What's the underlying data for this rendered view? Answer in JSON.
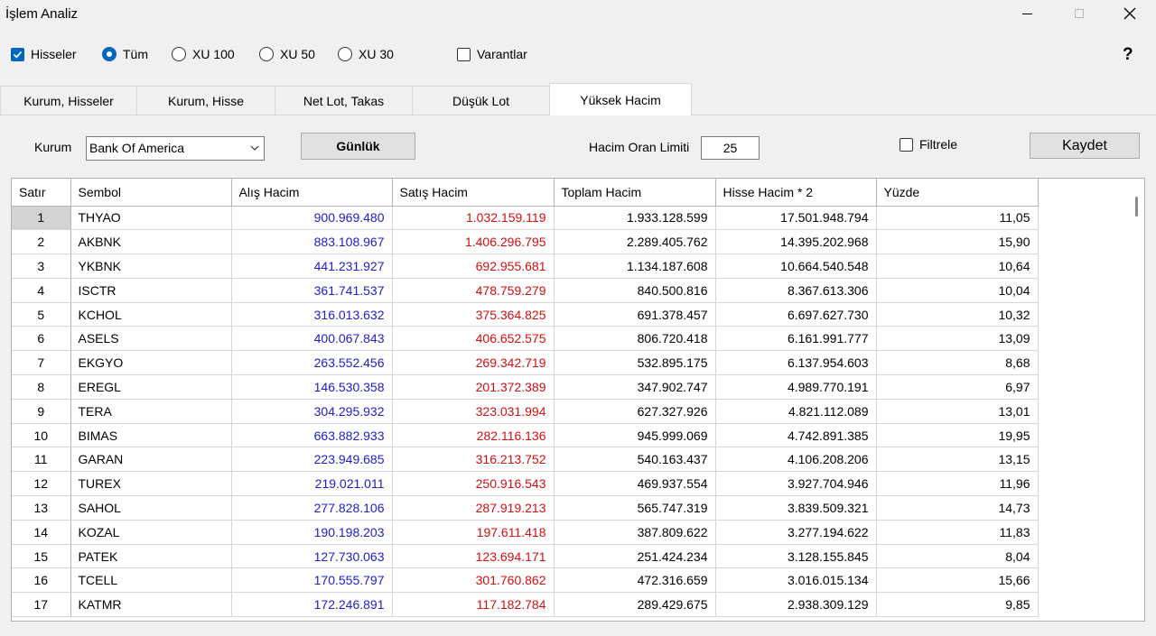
{
  "window": {
    "title": "İşlem Analiz"
  },
  "options": {
    "hisseler": {
      "label": "Hisseler",
      "checked": true
    },
    "radios": [
      {
        "label": "Tüm",
        "selected": true
      },
      {
        "label": "XU 100",
        "selected": false
      },
      {
        "label": "XU 50",
        "selected": false
      },
      {
        "label": "XU 30",
        "selected": false
      }
    ],
    "varantlar": {
      "label": "Varantlar",
      "checked": false
    },
    "help": "?"
  },
  "tabs": [
    {
      "label": "Kurum, Hisseler",
      "active": false
    },
    {
      "label": "Kurum, Hisse",
      "active": false
    },
    {
      "label": "Net Lot, Takas",
      "active": false
    },
    {
      "label": "Düşük Lot",
      "active": false
    },
    {
      "label": "Yüksek Hacim",
      "active": true
    }
  ],
  "filter": {
    "kurum_label": "Kurum",
    "kurum_value": "Bank Of America",
    "gunluk_button": "Günlük",
    "hacim_oran_label": "Hacim Oran Limiti",
    "hacim_oran_value": "25",
    "filtrele_label": "Filtrele",
    "filtrele_checked": false,
    "kaydet_button": "Kaydet"
  },
  "table": {
    "columns": [
      "Satır",
      "Sembol",
      "Alış Hacim",
      "Satış Hacim",
      "Toplam Hacim",
      "Hisse Hacim * 2",
      "Yüzde"
    ],
    "rows": [
      [
        "1",
        "THYAO",
        "900.969.480",
        "1.032.159.119",
        "1.933.128.599",
        "17.501.948.794",
        "11,05"
      ],
      [
        "2",
        "AKBNK",
        "883.108.967",
        "1.406.296.795",
        "2.289.405.762",
        "14.395.202.968",
        "15,90"
      ],
      [
        "3",
        "YKBNK",
        "441.231.927",
        "692.955.681",
        "1.134.187.608",
        "10.664.540.548",
        "10,64"
      ],
      [
        "4",
        "ISCTR",
        "361.741.537",
        "478.759.279",
        "840.500.816",
        "8.367.613.306",
        "10,04"
      ],
      [
        "5",
        "KCHOL",
        "316.013.632",
        "375.364.825",
        "691.378.457",
        "6.697.627.730",
        "10,32"
      ],
      [
        "6",
        "ASELS",
        "400.067.843",
        "406.652.575",
        "806.720.418",
        "6.161.991.777",
        "13,09"
      ],
      [
        "7",
        "EKGYO",
        "263.552.456",
        "269.342.719",
        "532.895.175",
        "6.137.954.603",
        "8,68"
      ],
      [
        "8",
        "EREGL",
        "146.530.358",
        "201.372.389",
        "347.902.747",
        "4.989.770.191",
        "6,97"
      ],
      [
        "9",
        "TERA",
        "304.295.932",
        "323.031.994",
        "627.327.926",
        "4.821.112.089",
        "13,01"
      ],
      [
        "10",
        "BIMAS",
        "663.882.933",
        "282.116.136",
        "945.999.069",
        "4.742.891.385",
        "19,95"
      ],
      [
        "11",
        "GARAN",
        "223.949.685",
        "316.213.752",
        "540.163.437",
        "4.106.208.206",
        "13,15"
      ],
      [
        "12",
        "TUREX",
        "219.021.011",
        "250.916.543",
        "469.937.554",
        "3.927.704.946",
        "11,96"
      ],
      [
        "13",
        "SAHOL",
        "277.828.106",
        "287.919.213",
        "565.747.319",
        "3.839.509.321",
        "14,73"
      ],
      [
        "14",
        "KOZAL",
        "190.198.203",
        "197.611.418",
        "387.809.622",
        "3.277.194.622",
        "11,83"
      ],
      [
        "15",
        "PATEK",
        "127.730.063",
        "123.694.171",
        "251.424.234",
        "3.128.155.845",
        "8,04"
      ],
      [
        "16",
        "TCELL",
        "170.555.797",
        "301.760.862",
        "472.316.659",
        "3.016.015.134",
        "15,66"
      ],
      [
        "17",
        "KATMR",
        "172.246.891",
        "117.182.784",
        "289.429.675",
        "2.938.309.129",
        "9,85"
      ]
    ]
  },
  "colors": {
    "buy": "#2020c8",
    "sell": "#d01010",
    "accent": "#0067c0"
  }
}
